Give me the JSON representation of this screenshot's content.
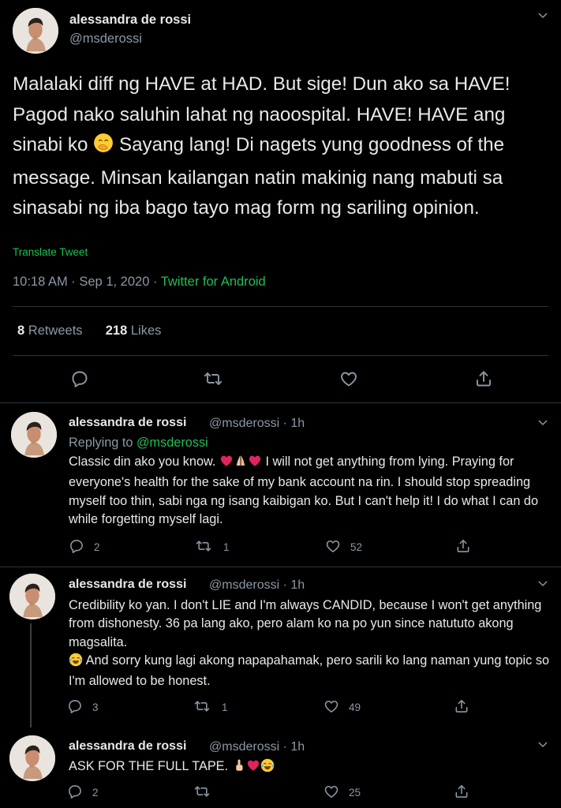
{
  "main_tweet": {
    "author_name": "alessandra de rossi",
    "author_handle": "@msderossi",
    "text": "Malalaki diff ng HAVE at HAD. But sige! Dun ako sa HAVE! Pagod nako saluhin lahat ng naoospital. HAVE! HAVE ang sinabi ko",
    "text_after_emoji": "Sayang lang! Di nagets yung goodness of the message. Minsan kailangan natin makinig nang mabuti sa sinasabi ng iba bago tayo mag form ng sariling opinion.",
    "translate_label": "Translate Tweet",
    "timestamp": "10:18 AM · Sep 1, 2020 ·",
    "source": "Twitter for Android",
    "retweets_count": "8",
    "retweets_label": "Retweets",
    "likes_count": "218",
    "likes_label": "Likes",
    "emoji_name": "face-with-hand-over-mouth"
  },
  "replies": [
    {
      "author_name": "alessandra de rossi",
      "meta": "@msderossi · 1h",
      "replying_to_label": "Replying to",
      "replying_to_handle": "@msderossi",
      "text_start": "Classic din ako you know.",
      "text_rest": "I will not get anything from lying. Praying for everyone's health for the sake of my bank account na rin. I should stop spreading myself too thin, sabi nga ng isang kaibigan ko. But I can't help it! I do what I can do while forgetting myself lagi.",
      "emojis": [
        "red-heart",
        "folded-hands",
        "red-heart"
      ],
      "reply_count": "2",
      "retweet_count": "1",
      "like_count": "52"
    },
    {
      "author_name": "alessandra de rossi",
      "meta": "@msderossi · 1h",
      "text_line1": "Credibility ko yan. I don't LIE and I'm always CANDID, because I won't get anything from dishonesty. 36 pa lang ako, pero alam ko na po yun since natututo akong magsalita.",
      "text_line2": "And sorry kung lagi akong napapahamak, pero sarili ko lang naman yung topic so I'm allowed to be honest.",
      "emojis": [
        "face-with-tears-of-joy"
      ],
      "reply_count": "3",
      "retweet_count": "1",
      "like_count": "49"
    },
    {
      "author_name": "alessandra de rossi",
      "meta": "@msderossi · 1h",
      "text": "ASK FOR THE FULL TAPE.",
      "emojis": [
        "index-pointing-up",
        "red-heart",
        "face-with-tears-of-joy"
      ],
      "reply_count": "2",
      "retweet_count": "",
      "like_count": "25"
    }
  ],
  "colors": {
    "background": "#000000",
    "text": "#e7e9ea",
    "muted": "#8b98a5",
    "accent_green": "#1fbf55",
    "divider": "#2f3336"
  }
}
